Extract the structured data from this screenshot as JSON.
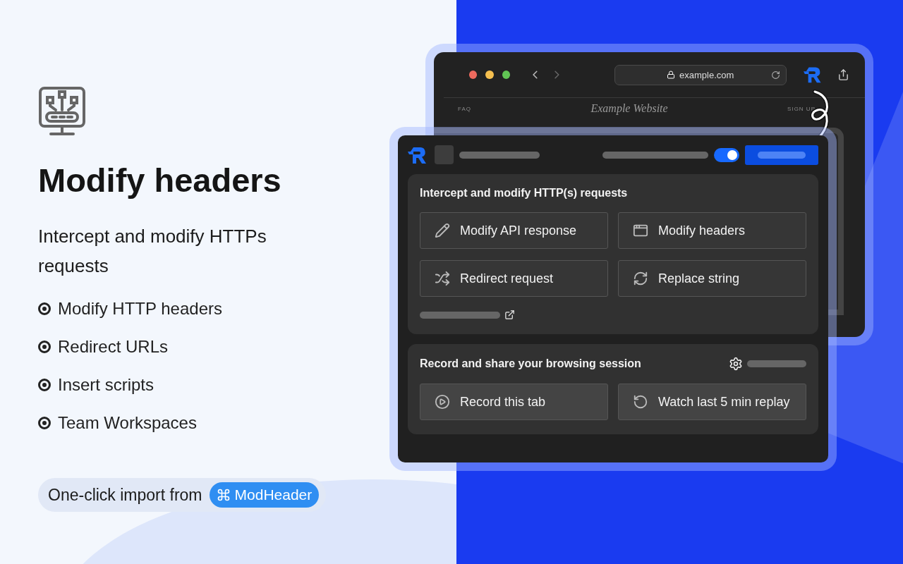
{
  "hero": {
    "title": "Modify headers",
    "subtitle": "Intercept and modify HTTPs requests",
    "features": [
      "Modify HTTP headers",
      "Redirect URLs",
      "Insert scripts",
      "Team Workspaces"
    ],
    "import": {
      "label": "One-click import from",
      "badge": "ModHeader"
    }
  },
  "browser": {
    "url": "example.com",
    "site_title": "Example Website",
    "site_nav": [
      "FAQ",
      "SIGN UP"
    ]
  },
  "popup": {
    "toggle": {
      "on": true
    },
    "sections": [
      {
        "kind": "rules",
        "title": "Intercept and modify HTTP(s) requests",
        "actions": [
          "Modify API response",
          "Modify headers",
          "Redirect request",
          "Replace string"
        ]
      },
      {
        "kind": "session",
        "title": "Record and share your browsing session",
        "actions": [
          "Record this tab",
          "Watch last 5 min replay"
        ]
      }
    ]
  }
}
